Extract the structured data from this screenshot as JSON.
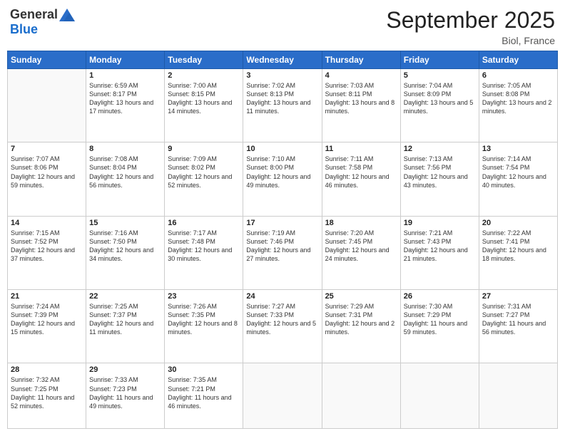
{
  "header": {
    "logo_general": "General",
    "logo_blue": "Blue",
    "title": "September 2025",
    "location": "Biol, France"
  },
  "days_of_week": [
    "Sunday",
    "Monday",
    "Tuesday",
    "Wednesday",
    "Thursday",
    "Friday",
    "Saturday"
  ],
  "weeks": [
    [
      {
        "day": "",
        "sunrise": "",
        "sunset": "",
        "daylight": ""
      },
      {
        "day": "1",
        "sunrise": "Sunrise: 6:59 AM",
        "sunset": "Sunset: 8:17 PM",
        "daylight": "Daylight: 13 hours and 17 minutes."
      },
      {
        "day": "2",
        "sunrise": "Sunrise: 7:00 AM",
        "sunset": "Sunset: 8:15 PM",
        "daylight": "Daylight: 13 hours and 14 minutes."
      },
      {
        "day": "3",
        "sunrise": "Sunrise: 7:02 AM",
        "sunset": "Sunset: 8:13 PM",
        "daylight": "Daylight: 13 hours and 11 minutes."
      },
      {
        "day": "4",
        "sunrise": "Sunrise: 7:03 AM",
        "sunset": "Sunset: 8:11 PM",
        "daylight": "Daylight: 13 hours and 8 minutes."
      },
      {
        "day": "5",
        "sunrise": "Sunrise: 7:04 AM",
        "sunset": "Sunset: 8:09 PM",
        "daylight": "Daylight: 13 hours and 5 minutes."
      },
      {
        "day": "6",
        "sunrise": "Sunrise: 7:05 AM",
        "sunset": "Sunset: 8:08 PM",
        "daylight": "Daylight: 13 hours and 2 minutes."
      }
    ],
    [
      {
        "day": "7",
        "sunrise": "Sunrise: 7:07 AM",
        "sunset": "Sunset: 8:06 PM",
        "daylight": "Daylight: 12 hours and 59 minutes."
      },
      {
        "day": "8",
        "sunrise": "Sunrise: 7:08 AM",
        "sunset": "Sunset: 8:04 PM",
        "daylight": "Daylight: 12 hours and 56 minutes."
      },
      {
        "day": "9",
        "sunrise": "Sunrise: 7:09 AM",
        "sunset": "Sunset: 8:02 PM",
        "daylight": "Daylight: 12 hours and 52 minutes."
      },
      {
        "day": "10",
        "sunrise": "Sunrise: 7:10 AM",
        "sunset": "Sunset: 8:00 PM",
        "daylight": "Daylight: 12 hours and 49 minutes."
      },
      {
        "day": "11",
        "sunrise": "Sunrise: 7:11 AM",
        "sunset": "Sunset: 7:58 PM",
        "daylight": "Daylight: 12 hours and 46 minutes."
      },
      {
        "day": "12",
        "sunrise": "Sunrise: 7:13 AM",
        "sunset": "Sunset: 7:56 PM",
        "daylight": "Daylight: 12 hours and 43 minutes."
      },
      {
        "day": "13",
        "sunrise": "Sunrise: 7:14 AM",
        "sunset": "Sunset: 7:54 PM",
        "daylight": "Daylight: 12 hours and 40 minutes."
      }
    ],
    [
      {
        "day": "14",
        "sunrise": "Sunrise: 7:15 AM",
        "sunset": "Sunset: 7:52 PM",
        "daylight": "Daylight: 12 hours and 37 minutes."
      },
      {
        "day": "15",
        "sunrise": "Sunrise: 7:16 AM",
        "sunset": "Sunset: 7:50 PM",
        "daylight": "Daylight: 12 hours and 34 minutes."
      },
      {
        "day": "16",
        "sunrise": "Sunrise: 7:17 AM",
        "sunset": "Sunset: 7:48 PM",
        "daylight": "Daylight: 12 hours and 30 minutes."
      },
      {
        "day": "17",
        "sunrise": "Sunrise: 7:19 AM",
        "sunset": "Sunset: 7:46 PM",
        "daylight": "Daylight: 12 hours and 27 minutes."
      },
      {
        "day": "18",
        "sunrise": "Sunrise: 7:20 AM",
        "sunset": "Sunset: 7:45 PM",
        "daylight": "Daylight: 12 hours and 24 minutes."
      },
      {
        "day": "19",
        "sunrise": "Sunrise: 7:21 AM",
        "sunset": "Sunset: 7:43 PM",
        "daylight": "Daylight: 12 hours and 21 minutes."
      },
      {
        "day": "20",
        "sunrise": "Sunrise: 7:22 AM",
        "sunset": "Sunset: 7:41 PM",
        "daylight": "Daylight: 12 hours and 18 minutes."
      }
    ],
    [
      {
        "day": "21",
        "sunrise": "Sunrise: 7:24 AM",
        "sunset": "Sunset: 7:39 PM",
        "daylight": "Daylight: 12 hours and 15 minutes."
      },
      {
        "day": "22",
        "sunrise": "Sunrise: 7:25 AM",
        "sunset": "Sunset: 7:37 PM",
        "daylight": "Daylight: 12 hours and 11 minutes."
      },
      {
        "day": "23",
        "sunrise": "Sunrise: 7:26 AM",
        "sunset": "Sunset: 7:35 PM",
        "daylight": "Daylight: 12 hours and 8 minutes."
      },
      {
        "day": "24",
        "sunrise": "Sunrise: 7:27 AM",
        "sunset": "Sunset: 7:33 PM",
        "daylight": "Daylight: 12 hours and 5 minutes."
      },
      {
        "day": "25",
        "sunrise": "Sunrise: 7:29 AM",
        "sunset": "Sunset: 7:31 PM",
        "daylight": "Daylight: 12 hours and 2 minutes."
      },
      {
        "day": "26",
        "sunrise": "Sunrise: 7:30 AM",
        "sunset": "Sunset: 7:29 PM",
        "daylight": "Daylight: 11 hours and 59 minutes."
      },
      {
        "day": "27",
        "sunrise": "Sunrise: 7:31 AM",
        "sunset": "Sunset: 7:27 PM",
        "daylight": "Daylight: 11 hours and 56 minutes."
      }
    ],
    [
      {
        "day": "28",
        "sunrise": "Sunrise: 7:32 AM",
        "sunset": "Sunset: 7:25 PM",
        "daylight": "Daylight: 11 hours and 52 minutes."
      },
      {
        "day": "29",
        "sunrise": "Sunrise: 7:33 AM",
        "sunset": "Sunset: 7:23 PM",
        "daylight": "Daylight: 11 hours and 49 minutes."
      },
      {
        "day": "30",
        "sunrise": "Sunrise: 7:35 AM",
        "sunset": "Sunset: 7:21 PM",
        "daylight": "Daylight: 11 hours and 46 minutes."
      },
      {
        "day": "",
        "sunrise": "",
        "sunset": "",
        "daylight": ""
      },
      {
        "day": "",
        "sunrise": "",
        "sunset": "",
        "daylight": ""
      },
      {
        "day": "",
        "sunrise": "",
        "sunset": "",
        "daylight": ""
      },
      {
        "day": "",
        "sunrise": "",
        "sunset": "",
        "daylight": ""
      }
    ]
  ]
}
